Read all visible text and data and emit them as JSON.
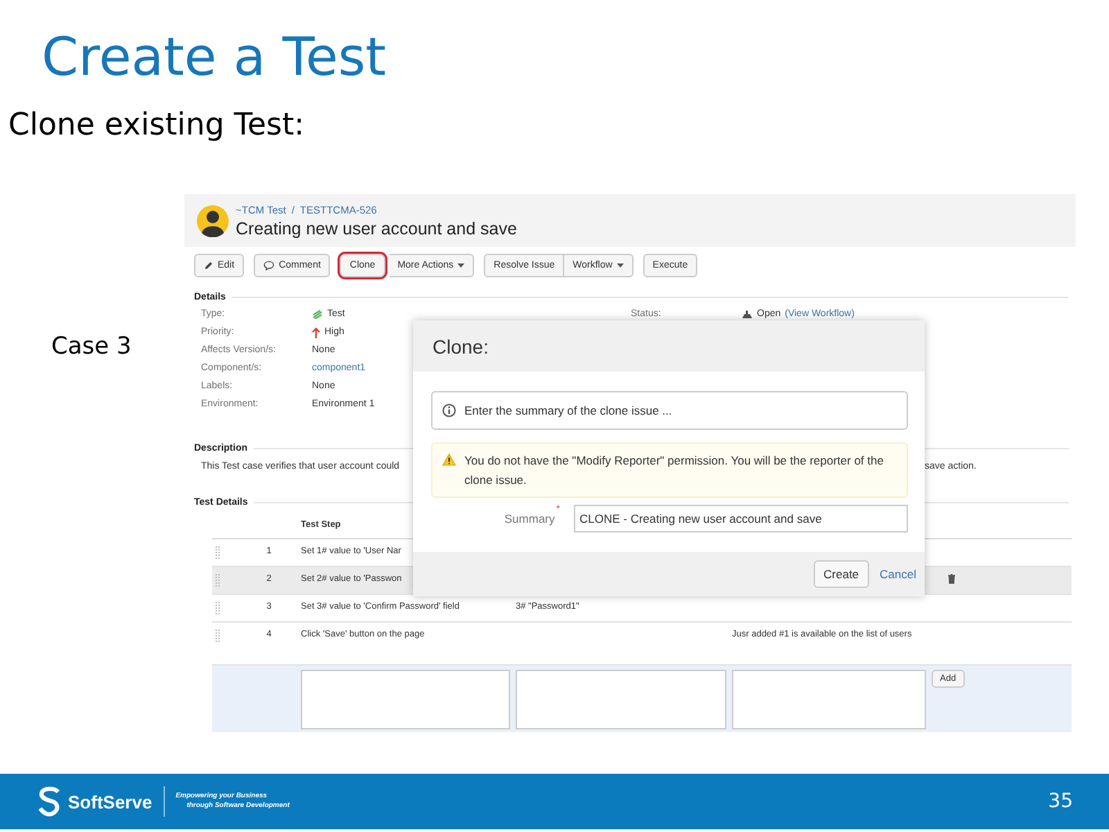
{
  "slide": {
    "title": "Create a Test",
    "subtitle": "Clone existing Test:",
    "case_label": "Case 3"
  },
  "issue": {
    "breadcrumb": [
      "~TCM Test",
      "TESTTCMA-526"
    ],
    "breadcrumb_separator": "/",
    "title": "Creating new user account and save"
  },
  "toolbar": [
    {
      "buttons": [
        {
          "label": "Edit",
          "kind": "edit",
          "dropdown": false,
          "highlighted": false
        }
      ]
    },
    {
      "buttons": [
        {
          "label": "Comment",
          "kind": "comment",
          "dropdown": false,
          "highlighted": false
        }
      ]
    },
    {
      "buttons": [
        {
          "label": "Clone",
          "kind": "plain",
          "dropdown": false,
          "highlighted": true
        },
        {
          "label": "More Actions",
          "kind": "plain",
          "dropdown": true,
          "highlighted": false
        }
      ]
    },
    {
      "buttons": [
        {
          "label": "Resolve Issue",
          "kind": "plain",
          "dropdown": false,
          "highlighted": false
        },
        {
          "label": "Workflow",
          "kind": "plain",
          "dropdown": true,
          "highlighted": false
        }
      ]
    },
    {
      "buttons": [
        {
          "label": "Execute",
          "kind": "plain",
          "dropdown": false,
          "highlighted": false
        }
      ]
    }
  ],
  "details": {
    "heading": "Details",
    "fields": [
      {
        "label": "Type:",
        "value": "Test",
        "kind": "type"
      },
      {
        "label": "Priority:",
        "value": "High",
        "kind": "priority"
      },
      {
        "label": "Affects Version/s:",
        "value": "None",
        "kind": "text"
      },
      {
        "label": "Component/s:",
        "value": "component1",
        "kind": "link"
      },
      {
        "label": "Labels:",
        "value": "None",
        "kind": "text"
      },
      {
        "label": "Environment:",
        "value": "Environment 1",
        "kind": "text"
      }
    ],
    "status": {
      "label": "Status:",
      "value": "Open",
      "link": "(View Workflow)"
    }
  },
  "description": {
    "heading": "Description",
    "text_start": "This Test case verifies that user account could",
    "text_end": "save action."
  },
  "test_details": {
    "heading": "Test Details",
    "columns": [
      "Test Step"
    ],
    "rows": [
      {
        "number": "1",
        "step": "Set 1# value to 'User Nar",
        "selected": false
      },
      {
        "number": "2",
        "step": "Set 2# value to 'Passwon",
        "selected": true
      },
      {
        "number": "3",
        "step": "Set 3# value to 'Confirm Password' field",
        "data": "3# \"Password1\"",
        "selected": false
      },
      {
        "number": "4",
        "step": "Click 'Save' button on the page",
        "result": "Jusr added #1 is available on the list of users",
        "selected": false
      }
    ],
    "add_button": "Add"
  },
  "dialog": {
    "title": "Clone:",
    "info": "Enter the summary of the clone issue ...",
    "warning": "You do not have the \"Modify Reporter\" permission. You will be the reporter of the clone issue.",
    "summary": {
      "label": "Summary",
      "required_mark": "*",
      "value": "CLONE - Creating new user account and save"
    },
    "create_button": "Create",
    "cancel_link": "Cancel"
  },
  "footer": {
    "brand": "SoftServe",
    "tagline": [
      "Empowering your Business",
      "through Software Development"
    ],
    "page_number": "35"
  }
}
